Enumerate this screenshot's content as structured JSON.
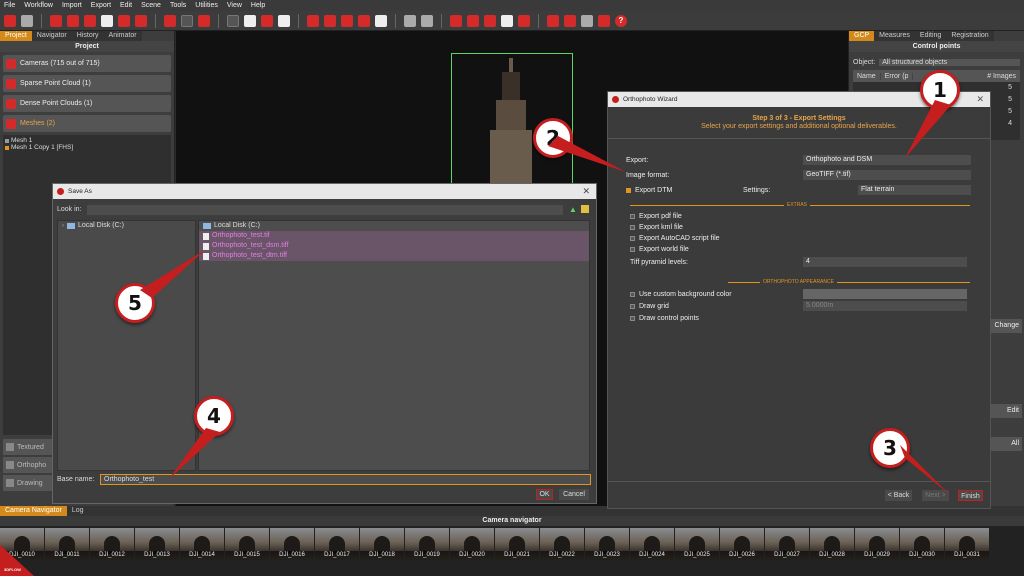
{
  "menu": [
    "File",
    "Workflow",
    "Import",
    "Export",
    "Edit",
    "Scene",
    "Tools",
    "Utilities",
    "View",
    "Help"
  ],
  "left_panel": {
    "tabs": [
      "Project",
      "Navigator",
      "History",
      "Animator"
    ],
    "title": "Project",
    "items": [
      {
        "label": "Cameras (715 out of 715)"
      },
      {
        "label": "Sparse Point Cloud (1)"
      },
      {
        "label": "Dense Point Clouds (1)"
      },
      {
        "label": "Meshes (2)"
      }
    ],
    "meshes": [
      "Mesh 1",
      "Mesh 1 Copy 1 [FHS]"
    ],
    "lower_items": [
      "Textured",
      "Orthopho",
      "Drawing"
    ]
  },
  "right_panel": {
    "tabs": [
      "GCP",
      "Measures",
      "Editing",
      "Registration"
    ],
    "title": "Control points",
    "object_label": "Object:",
    "object_value": "All structured objects",
    "columns": [
      "Name",
      "Error (p",
      "# Images"
    ],
    "image_counts": [
      "5",
      "5",
      "5",
      "4"
    ],
    "buttons": [
      "Change",
      "Edit",
      "All"
    ]
  },
  "wizard": {
    "title": "Orthophoto Wizard",
    "step": "Step 3 of 3 - Export Settings",
    "subtitle": "Select your export settings and additional optional deliverables.",
    "export_label": "Export:",
    "export_value": "Orthophoto and DSM",
    "format_label": "Image format:",
    "format_value": "GeoTIFF (*.tif)",
    "dtm_label": "Export DTM",
    "settings_label": "Settings:",
    "settings_value": "Flat terrain",
    "extras_header": "EXTRAS",
    "extras": [
      "Export pdf file",
      "Export kml file",
      "Export AutoCAD script file",
      "Export world file"
    ],
    "tiff_label": "Tiff pyramid levels:",
    "tiff_value": "4",
    "appearance_header": "ORTHOPHOTO APPEARANCE",
    "appearance": [
      "Use custom background color",
      "Draw grid",
      "Draw control points"
    ],
    "grid_value": "5.0000m",
    "back": "< Back",
    "next": "Next >",
    "finish": "Finish"
  },
  "saveas": {
    "title": "Save As",
    "look_in_label": "Look in:",
    "tree_item": "Local Disk (C:)",
    "files": [
      {
        "name": "Local Disk (C:)",
        "kind": "drive"
      },
      {
        "name": "Orthophoto_test.tif",
        "kind": "file"
      },
      {
        "name": "Orthophoto_test_dsm.tiff",
        "kind": "file"
      },
      {
        "name": "Orthophoto_test_dtm.tiff",
        "kind": "file"
      }
    ],
    "base_name_label": "Base name:",
    "base_name_value": "Orthophoto_test",
    "ok": "OK",
    "cancel": "Cancel"
  },
  "bottom": {
    "tabs": [
      "Camera Navigator",
      "Log"
    ],
    "title": "Camera navigator",
    "thumbs": [
      "DJI_0010",
      "DJI_0011",
      "DJI_0012",
      "DJI_0013",
      "DJI_0014",
      "DJI_0015",
      "DJI_0016",
      "DJI_0017",
      "DJI_0018",
      "DJI_0019",
      "DJI_0020",
      "DJI_0021",
      "DJI_0022",
      "DJI_0023",
      "DJI_0024",
      "DJI_0025",
      "DJI_0026",
      "DJI_0027",
      "DJI_0028",
      "DJI_0029",
      "DJI_0030",
      "DJI_0031"
    ],
    "logo": "3DFLOW"
  },
  "callouts": [
    "1",
    "2",
    "3",
    "4",
    "5"
  ],
  "colors": {
    "accent": "#e09422",
    "brand_red": "#c41e1e",
    "frame_green": "#5ed65e",
    "file_pink": "#e57fe6"
  }
}
